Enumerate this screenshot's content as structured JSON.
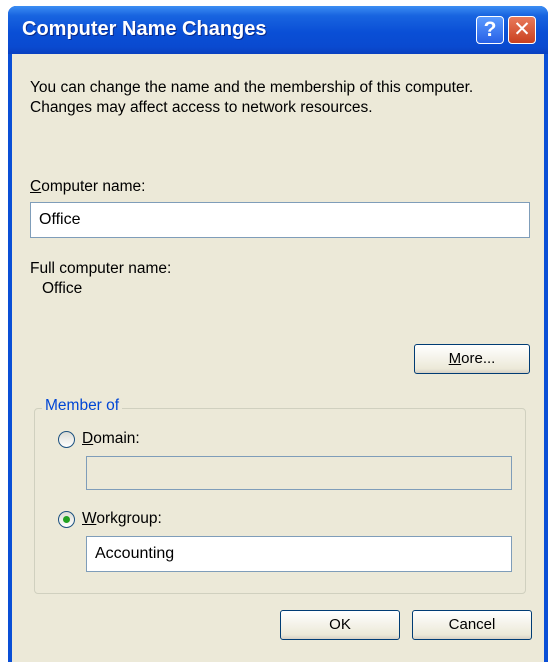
{
  "window": {
    "title": "Computer Name Changes"
  },
  "titlebar": {
    "help_glyph": "?",
    "close_glyph": "✕",
    "help_icon": "help-icon",
    "close_icon": "close-icon"
  },
  "description": "You can change the name and the membership of this computer. Changes may affect access to network resources.",
  "computer_name": {
    "label_accel": "C",
    "label_rest": "omputer name:",
    "value": "Office"
  },
  "full_name": {
    "label": "Full computer name:",
    "value": "Office"
  },
  "more_button": {
    "accel": "M",
    "rest": "ore..."
  },
  "member_of": {
    "legend": "Member of",
    "domain": {
      "accel": "D",
      "rest": "omain:",
      "selected": false,
      "value": ""
    },
    "workgroup": {
      "accel": "W",
      "rest": "orkgroup:",
      "selected": true,
      "value": "Accounting"
    }
  },
  "footer": {
    "ok_label": "OK",
    "cancel_label": "Cancel"
  },
  "colors": {
    "title_bar": "#0a4fd6",
    "dialog_bg": "#ece9d8",
    "group_legend": "#0046d5",
    "radio_selected": "#21a121"
  }
}
